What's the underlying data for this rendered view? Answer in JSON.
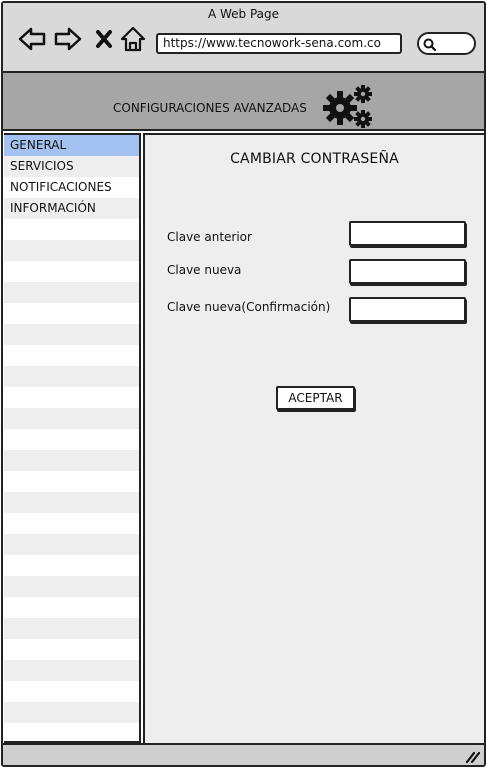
{
  "window": {
    "title": "A Web Page"
  },
  "browser": {
    "url": "https://www.tecnowork-sena.com.co",
    "icons": [
      "back-arrow-icon",
      "forward-arrow-icon",
      "close-icon",
      "home-icon",
      "search-icon"
    ]
  },
  "header": {
    "title": "CONFIGURACIONES AVANZADAS",
    "icon": "gears-icon"
  },
  "sidebar": {
    "items": [
      {
        "label": "GENERAL",
        "selected": true
      },
      {
        "label": "SERVICIOS",
        "selected": false
      },
      {
        "label": "NOTIFICACIONES",
        "selected": false
      },
      {
        "label": "INFORMACIÓN",
        "selected": false
      }
    ]
  },
  "form": {
    "title": "CAMBIAR CONTRASEÑA",
    "fields": [
      {
        "label": "Clave anterior",
        "value": ""
      },
      {
        "label": "Clave nueva",
        "value": ""
      },
      {
        "label": "Clave nueva(Confirmación)",
        "value": ""
      }
    ],
    "submit_label": "ACEPTAR"
  },
  "colors": {
    "chrome": "#d9d9d9",
    "header": "#a6a6a6",
    "selected": "#a4c2f1",
    "panel": "#eeeeee",
    "border": "#222222"
  }
}
